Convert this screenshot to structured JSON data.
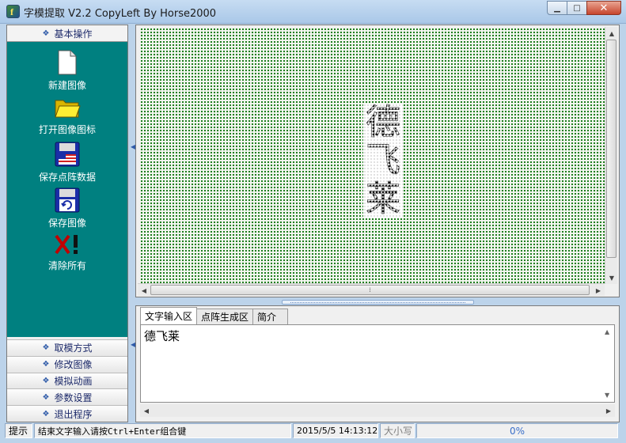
{
  "window": {
    "title": "字模提取 V2.2  CopyLeft By Horse2000",
    "icon_glyph": "f",
    "min_glyph": "▁",
    "max_glyph": "□",
    "close_glyph": "✕"
  },
  "sidebar": {
    "top_group": "基本操作",
    "tools": [
      {
        "label": "新建图像",
        "icon": "new-file-icon"
      },
      {
        "label": "打开图像图标",
        "icon": "folder-icon"
      },
      {
        "label": "保存点阵数据",
        "icon": "floppy-flag-icon"
      },
      {
        "label": "保存图像",
        "icon": "floppy-save-icon"
      },
      {
        "label": "清除所有",
        "icon": "clear-all-icon"
      }
    ],
    "groups": [
      "取模方式",
      "修改图像",
      "模拟动画",
      "参数设置",
      "退出程序"
    ]
  },
  "canvas": {
    "glyph_chars": [
      "德",
      "飞",
      "莱"
    ],
    "dot_color": "#1f7e1f"
  },
  "tabs": [
    "文字输入区",
    "点阵生成区",
    "简介"
  ],
  "text_input": {
    "value": "德飞莱"
  },
  "statusbar": {
    "hint": "提示",
    "message": "结束文字输入请按Ctrl+Enter组合键",
    "datetime": "2015/5/5 14:13:12",
    "caps": "大小写",
    "progress": "0%"
  },
  "colors": {
    "sidebar_bg": "#008080",
    "chrome_bg": "#bcd3ea"
  }
}
